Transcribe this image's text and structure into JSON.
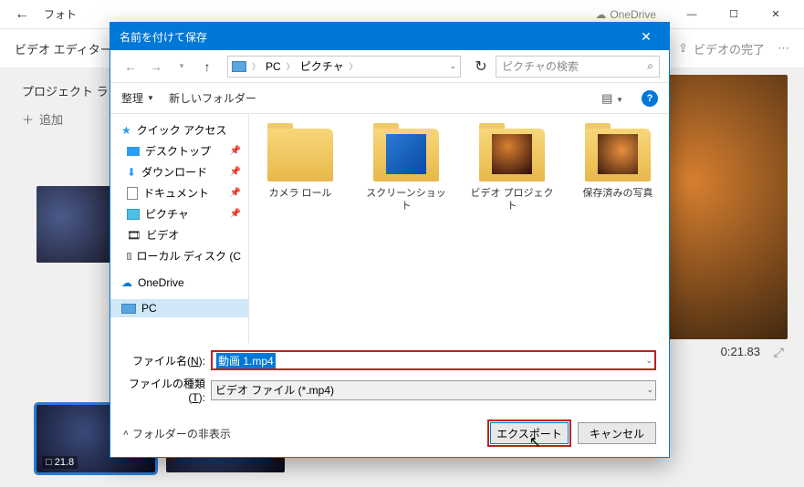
{
  "bg": {
    "app_title": "フォト",
    "onedrive": "OneDrive",
    "breadcrumb": "ビデオ エディター",
    "finish": "ビデオの完了",
    "library_label": "プロジェクト ライブ",
    "add": "追加",
    "time": "0:21.83",
    "clip1_dur": "□ 21.8"
  },
  "dialog": {
    "title": "名前を付けて保存",
    "path_pc": "PC",
    "path_pic": "ピクチャ",
    "search_placeholder": "ピクチャの検索",
    "organize": "整理",
    "new_folder": "新しいフォルダー",
    "tree": {
      "quick": "クイック アクセス",
      "desktop": "デスクトップ",
      "downloads": "ダウンロード",
      "documents": "ドキュメント",
      "pictures": "ピクチャ",
      "videos": "ビデオ",
      "localdisk": "ローカル ディスク (C",
      "onedrive": "OneDrive",
      "pc": "PC"
    },
    "folders": {
      "f1": "カメラ ロール",
      "f2": "スクリーンショット",
      "f3": "ビデオ プロジェクト",
      "f4": "保存済みの写真"
    },
    "filename_label_pre": "ファイル名(",
    "filename_label_u": "N",
    "filename_label_post": "):",
    "filetype_label_pre": "ファイルの種類(",
    "filetype_label_u": "T",
    "filetype_label_post": "):",
    "filename_value": "動画 1.mp4",
    "filetype_value": "ビデオ ファイル (*.mp4)",
    "hide_folders": "フォルダーの非表示",
    "export": "エクスポート",
    "cancel": "キャンセル"
  }
}
